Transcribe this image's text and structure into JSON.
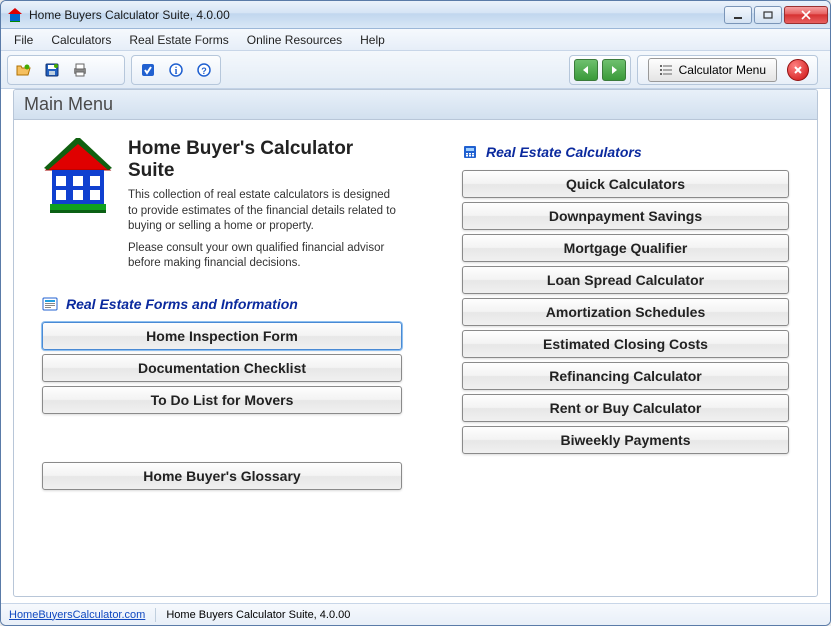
{
  "window": {
    "title": "Home Buyers Calculator Suite, 4.0.00"
  },
  "menu": {
    "file": "File",
    "calculators": "Calculators",
    "real_estate_forms": "Real Estate Forms",
    "online_resources": "Online Resources",
    "help": "Help"
  },
  "toolbar": {
    "calculator_menu": "Calculator Menu"
  },
  "frame": {
    "title": "Main Menu"
  },
  "intro": {
    "heading": "Home Buyer's Calculator Suite",
    "p1": "This collection of real estate calculators is designed to provide estimates of the financial details related to buying or selling a home or property.",
    "p2": "Please consult your own qualified financial advisor before making financial decisions."
  },
  "forms_section": {
    "title": "Real Estate Forms and Information",
    "buttons": [
      "Home Inspection Form",
      "Documentation Checklist",
      "To Do List for Movers"
    ],
    "glossary": "Home Buyer's Glossary"
  },
  "calc_section": {
    "title": "Real Estate Calculators",
    "buttons": [
      "Quick Calculators",
      "Downpayment Savings",
      "Mortgage Qualifier",
      "Loan Spread Calculator",
      "Amortization Schedules",
      "Estimated Closing Costs",
      "Refinancing Calculator",
      "Rent or Buy Calculator",
      "Biweekly Payments"
    ]
  },
  "status": {
    "link": "HomeBuyersCalculator.com",
    "text": "Home Buyers Calculator Suite, 4.0.00"
  }
}
